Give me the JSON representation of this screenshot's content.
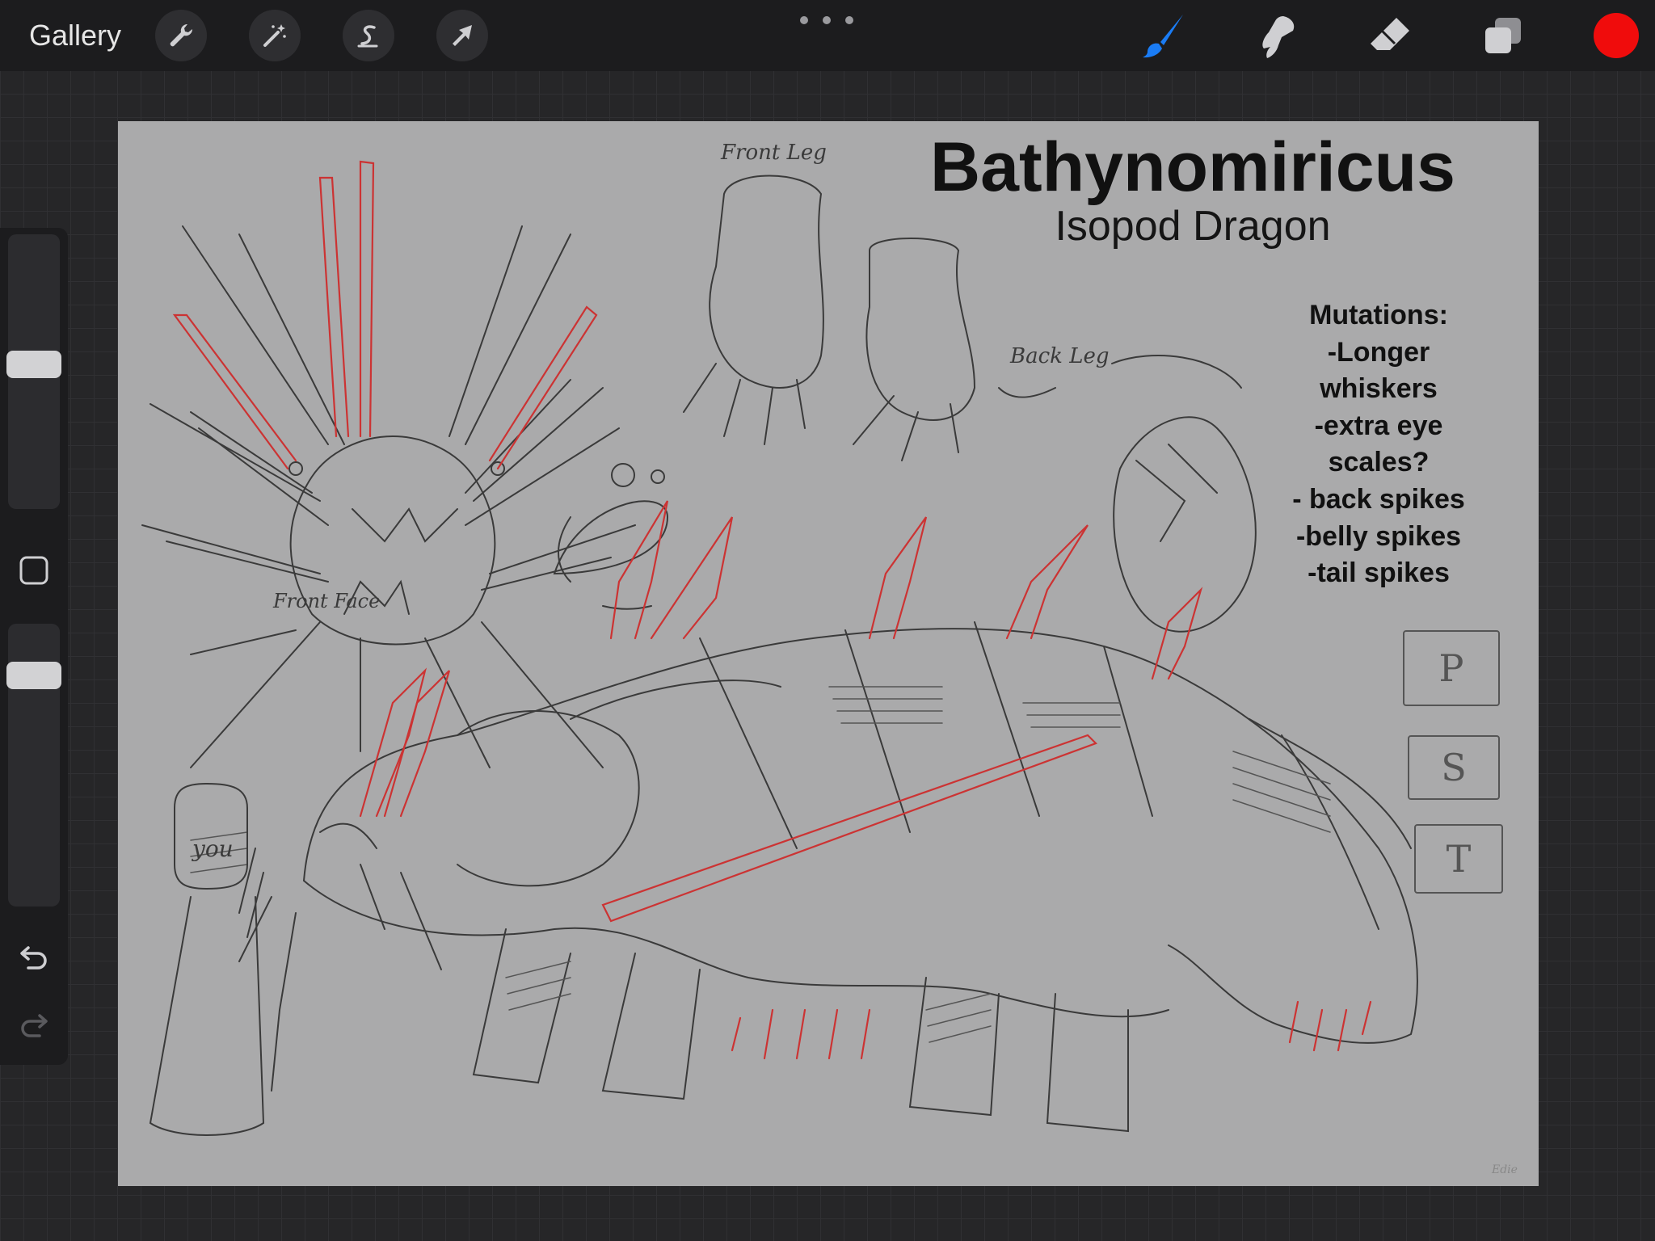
{
  "topbar": {
    "gallery_label": "Gallery",
    "tools": [
      {
        "name": "actions-wrench-icon"
      },
      {
        "name": "adjustments-magic-wand-icon"
      },
      {
        "name": "selection-s-icon"
      },
      {
        "name": "transform-arrow-icon"
      }
    ],
    "right_tools": [
      {
        "name": "brush-icon",
        "active_color": "#1a7cf5"
      },
      {
        "name": "smudge-icon"
      },
      {
        "name": "eraser-icon"
      },
      {
        "name": "layers-icon"
      }
    ],
    "current_color": "#f00c0c"
  },
  "sidebar": {
    "brush_size": 0.53,
    "opacity": 0.85,
    "icons": [
      "modify-square-icon",
      "undo-icon",
      "redo-icon"
    ]
  },
  "artwork": {
    "title": "Bathynomiricus",
    "subtitle": "Isopod Dragon",
    "mutations": [
      "Mutations:",
      "-Longer",
      "whiskers",
      "-extra eye",
      "scales?",
      "- back spikes",
      "-belly spikes",
      "-tail spikes"
    ],
    "labels": {
      "front_leg": "Front Leg",
      "back_leg": "Back Leg",
      "front_face": "Front Face",
      "you": "you",
      "signature": "Edie"
    },
    "boxes": [
      "P",
      "S",
      "T"
    ]
  }
}
